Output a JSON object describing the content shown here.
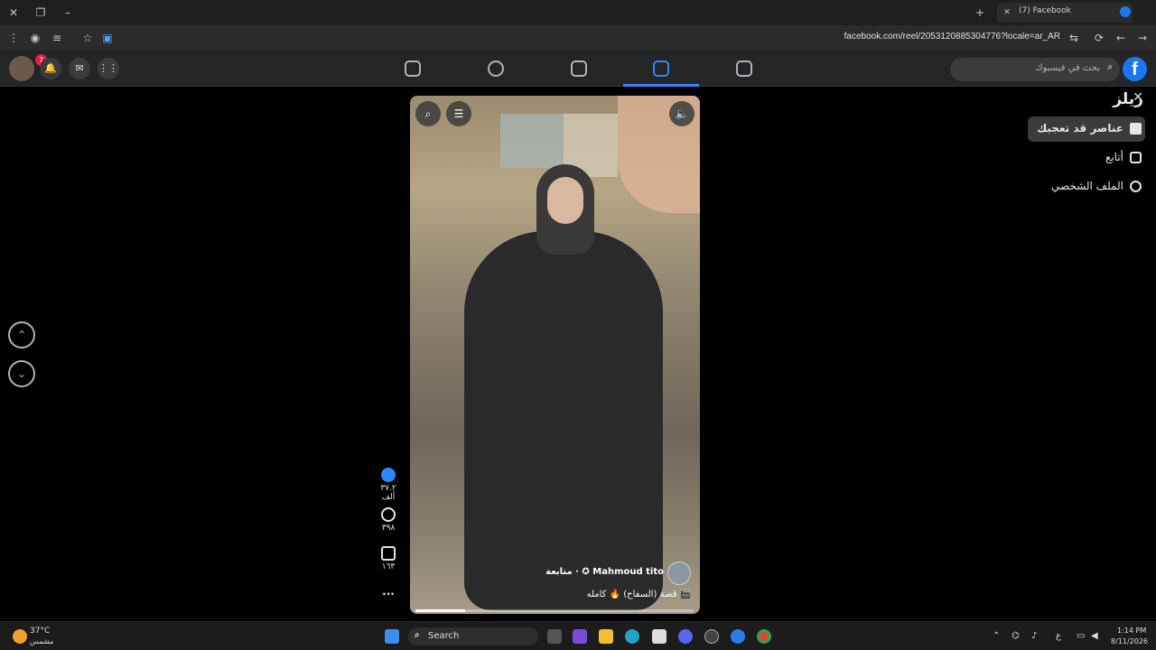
{
  "browser": {
    "tab_title": "(7) Facebook",
    "url": "facebook.com/reel/2053120885304776?locale=ar_AR",
    "new_tab_label": "+",
    "close_label": "✕",
    "back_label": "←",
    "forward_label": "→",
    "reload_label": "⟳"
  },
  "header": {
    "notifications_badge": "7",
    "search_placeholder": "بحث في فيسبوك",
    "logo": "f"
  },
  "reels_menu": {
    "title": "ريلز",
    "items": [
      {
        "label": "عناصر قد تعجبك",
        "icon": "star-icon",
        "active": true
      },
      {
        "label": "أتابع",
        "icon": "following-icon",
        "active": false
      },
      {
        "label": "الملف الشخصي",
        "icon": "profile-icon",
        "active": false
      }
    ]
  },
  "reel": {
    "author": "Mahmoud tito",
    "follow_label": "متابعة",
    "caption": "قصة (السفاح) 🔥 كامله 🎬",
    "progress": 0.18
  },
  "actions": {
    "likes": "٣٧.٢ ألف",
    "comments": "٣٩٨",
    "shares": "١٦٣",
    "more": "..."
  },
  "taskbar": {
    "weather_temp": "37°C",
    "weather_desc": "مشمس",
    "search_label": "Search",
    "time": "1:14 PM",
    "date": "8/11/2026",
    "lang": "ع"
  },
  "colors": {
    "accent": "#2d88ff",
    "fb_blue": "#1877f2",
    "bg": "#000000"
  }
}
